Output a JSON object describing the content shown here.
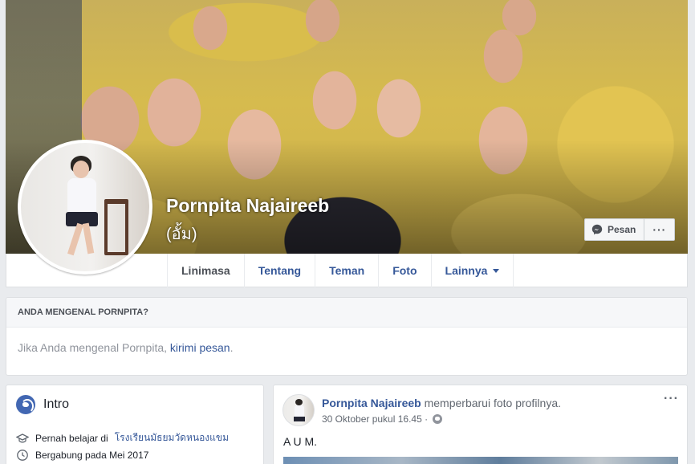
{
  "profile": {
    "name": "Pornpita Najaireeb",
    "alt_name": "(อั้ม)"
  },
  "actions": {
    "message_label": "Pesan",
    "more_label": "···"
  },
  "nav": {
    "tabs": [
      {
        "label": "Linimasa",
        "active": true
      },
      {
        "label": "Tentang"
      },
      {
        "label": "Teman"
      },
      {
        "label": "Foto"
      },
      {
        "label": "Lainnya"
      }
    ]
  },
  "know_card": {
    "title": "ANDA MENGENAL PORNPITA?",
    "text": "Jika Anda mengenal Pornpita,",
    "link": "kirimi pesan",
    "end": "."
  },
  "intro": {
    "title": "Intro",
    "studied_prefix": "Pernah belajar di",
    "studied_school": "โรงเรียนมัธยมวัดหนองแขม",
    "joined": "Bergabung pada Mei 2017"
  },
  "post": {
    "author": "Pornpita Najaireeb",
    "action": "memperbarui foto profilnya.",
    "time": "30 Oktober pukul 16.45 ·",
    "text": "A U M.",
    "more_label": "···"
  },
  "colors": {
    "link": "#365899",
    "accent": "#4267b2",
    "background": "#e9ebee"
  }
}
